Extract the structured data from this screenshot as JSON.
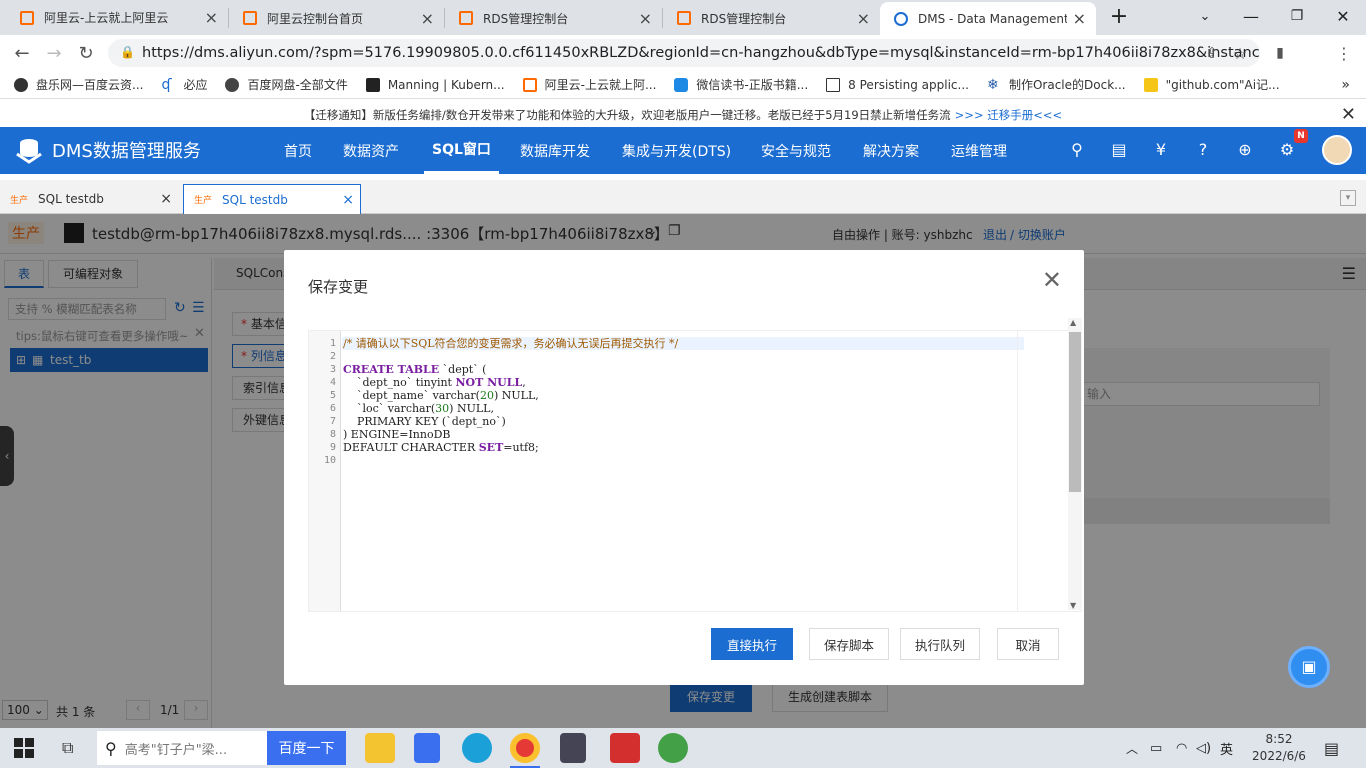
{
  "browser": {
    "tabs": [
      {
        "title": "阿里云-上云就上阿里云"
      },
      {
        "title": "阿里云控制台首页"
      },
      {
        "title": "RDS管理控制台"
      },
      {
        "title": "RDS管理控制台"
      },
      {
        "title": "DMS - Data Management"
      }
    ],
    "url": "https://dms.aliyun.com/?spm=5176.19909805.0.0.cf611450xRBLZD&regionId=cn-hangzhou&dbType=mysql&instanceId=rm-bp17h406ii8i78zx8&instance...",
    "profile_initial": "c",
    "bookmarks": [
      "盘乐网—百度云资...",
      "必应",
      "百度网盘-全部文件",
      "Manning | Kubern...",
      "阿里云-上云就上阿...",
      "微信读书-正版书籍...",
      "8 Persisting applic...",
      "制作Oracle的Dock...",
      "\"github.com\"Ai记..."
    ],
    "more": "»"
  },
  "notice": {
    "text": "【迁移通知】新版任务编排/数仓开发带来了功能和体验的大升级，欢迎老版用户一键迁移。老版已经于5月19日禁止新增任务流",
    "link": ">>> 迁移手册<<<"
  },
  "dms": {
    "logo": "DMS数据管理服务",
    "menu": [
      "首页",
      "数据资产",
      "SQL窗口",
      "数据库开发",
      "集成与开发(DTS)",
      "安全与规范",
      "解决方案",
      "运维管理"
    ],
    "badge": "N"
  },
  "sql_tabs": [
    {
      "env": "生产",
      "label": "SQL testdb"
    },
    {
      "env": "生产",
      "label": "SQL testdb"
    }
  ],
  "connection": {
    "env": "生产",
    "text": "testdb@rm-bp17h406ii8i78zx8.mysql.rds.... :3306【rm-bp17h406ii8i78zx8】",
    "mode": "自由操作 | 账号: yshbzhc",
    "logout": "退出",
    "switch": "/ 切换账户"
  },
  "left_panel": {
    "tabs": [
      "表",
      "可编程对象"
    ],
    "search_placeholder": "支持 % 模糊匹配表名称",
    "tips": "tips:鼠标右键可查看更多操作哦~",
    "tree_item": "test_tb",
    "page_size": "100",
    "total": "共 1 条",
    "page": "1/1"
  },
  "behind": {
    "console_tab": "SQLCons",
    "side_items": [
      "基本信",
      "列信息",
      "索引信息",
      "外键信息"
    ],
    "input_hint": "输入",
    "save_btn": "保存变更",
    "gen_btn": "生成创建表脚本"
  },
  "modal": {
    "title": "保存变更",
    "code_lines": [
      "/* 请确认以下SQL符合您的变更需求，务必确认无误后再提交执行 */",
      "",
      "CREATE TABLE `dept` (",
      "    `dept_no` tinyint NOT NULL,",
      "    `dept_name` varchar(20) NULL,",
      "    `loc` varchar(30) NULL,",
      "    PRIMARY KEY (`dept_no`)",
      ") ENGINE=InnoDB",
      "DEFAULT CHARACTER SET=utf8;",
      ""
    ],
    "buttons": {
      "execute": "直接执行",
      "save_script": "保存脚本",
      "queue": "执行队列",
      "cancel": "取消"
    }
  },
  "taskbar": {
    "search_text": "高考\"钉子户\"梁...",
    "search_button": "百度一下",
    "ime": "英",
    "time": "8:52",
    "date": "2022/6/6"
  }
}
